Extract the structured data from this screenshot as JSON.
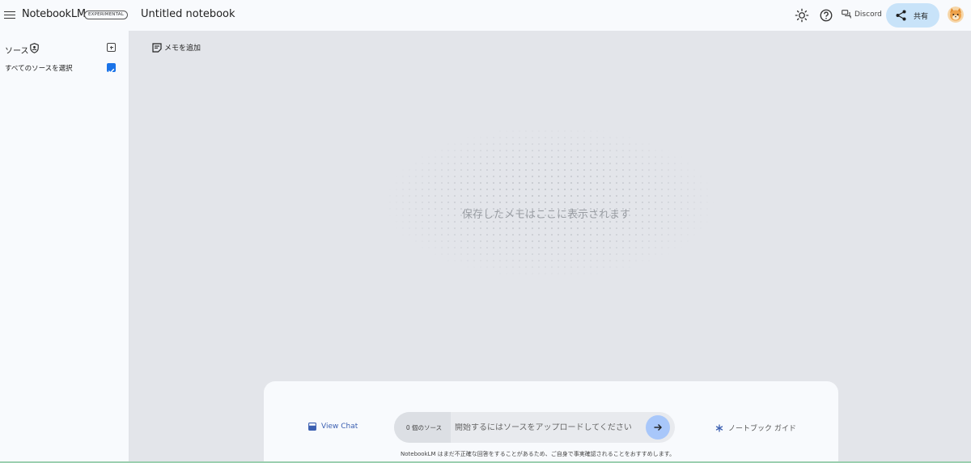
{
  "header": {
    "brand": "NotebookLM",
    "badge": "EXPERIMENTAL",
    "notebook_title": "Untitled notebook",
    "discord_label": "Discord",
    "share_label": "共有",
    "icons": [
      "menu-icon",
      "theme-icon",
      "help-icon",
      "discord-icon",
      "share-icon",
      "avatar"
    ]
  },
  "sidebar": {
    "sources_label": "ソース",
    "select_all_label": "すべてのソースを選択",
    "select_all_checked": true
  },
  "main": {
    "add_memo_label": "メモを追加",
    "empty_state": "保存したメモはここに表示されます"
  },
  "chat": {
    "view_chat_label": "View Chat",
    "source_count": "0 個のソース",
    "input_placeholder": "開始するにはソースをアップロードしてください",
    "notebook_guide_label": "ノートブック ガイド",
    "disclaimer": "NotebookLM はまだ不正確な回答をすることがあるため、ご自身で事実確認されることをおすすめします。"
  },
  "colors": {
    "accent": "#1a73e8",
    "share_bg": "#c8e3f9",
    "send_bg": "#a8c7fa",
    "canvas_bg": "#e3e5ea",
    "panel_bg": "#f8fafd"
  }
}
